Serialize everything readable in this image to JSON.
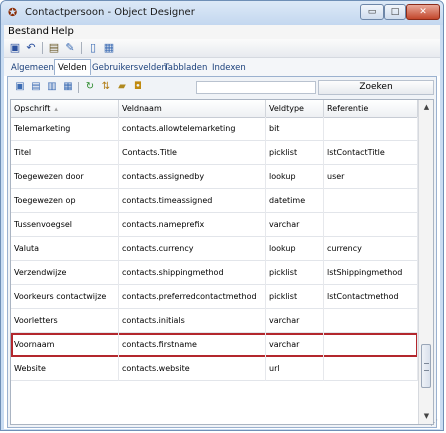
{
  "window": {
    "title": "Contactpersoon - Object Designer"
  },
  "window_buttons": {
    "minimize": "▭",
    "maximize": "□",
    "close": "✕"
  },
  "menu": [
    {
      "label": "Bestand"
    },
    {
      "label": "Help"
    }
  ],
  "tabs": [
    {
      "label": "Algemeen",
      "active": false
    },
    {
      "label": "Velden",
      "active": true
    },
    {
      "label": "Gebruikersvelden",
      "active": false
    },
    {
      "label": "Tabbladen",
      "active": false
    },
    {
      "label": "Indexen",
      "active": false
    }
  ],
  "search": {
    "button_label": "Zoeken",
    "value": ""
  },
  "grid": {
    "columns": [
      "Opschrift",
      "Veldnaam",
      "Veldtype",
      "Referentie"
    ],
    "sorted_column": "Opschrift",
    "rows": [
      [
        "Telemarketing",
        "contacts.allowtelemarketing",
        "bit",
        ""
      ],
      [
        "Titel",
        "Contacts.Title",
        "picklist",
        "lstContactTitle"
      ],
      [
        "Toegewezen door",
        "contacts.assignedby",
        "lookup",
        "user"
      ],
      [
        "Toegewezen op",
        "contacts.timeassigned",
        "datetime",
        ""
      ],
      [
        "Tussenvoegsel",
        "contacts.nameprefix",
        "varchar",
        ""
      ],
      [
        "Valuta",
        "contacts.currency",
        "lookup",
        "currency"
      ],
      [
        "Verzendwijze",
        "contacts.shippingmethod",
        "picklist",
        "lstShippingmethod"
      ],
      [
        "Voorkeurs contactwijze",
        "contacts.preferredcontactmethod",
        "picklist",
        "lstContactmethod"
      ],
      [
        "Voorletters",
        "contacts.initials",
        "varchar",
        ""
      ],
      [
        "Voornaam",
        "contacts.firstname",
        "varchar",
        ""
      ],
      [
        "Website",
        "contacts.website",
        "url",
        ""
      ]
    ],
    "selected_row_index": 9
  },
  "colors": {
    "selection_outline": "#b3272d",
    "window_frame": "#c9dcf2",
    "tab_text": "#1a3f7a"
  }
}
